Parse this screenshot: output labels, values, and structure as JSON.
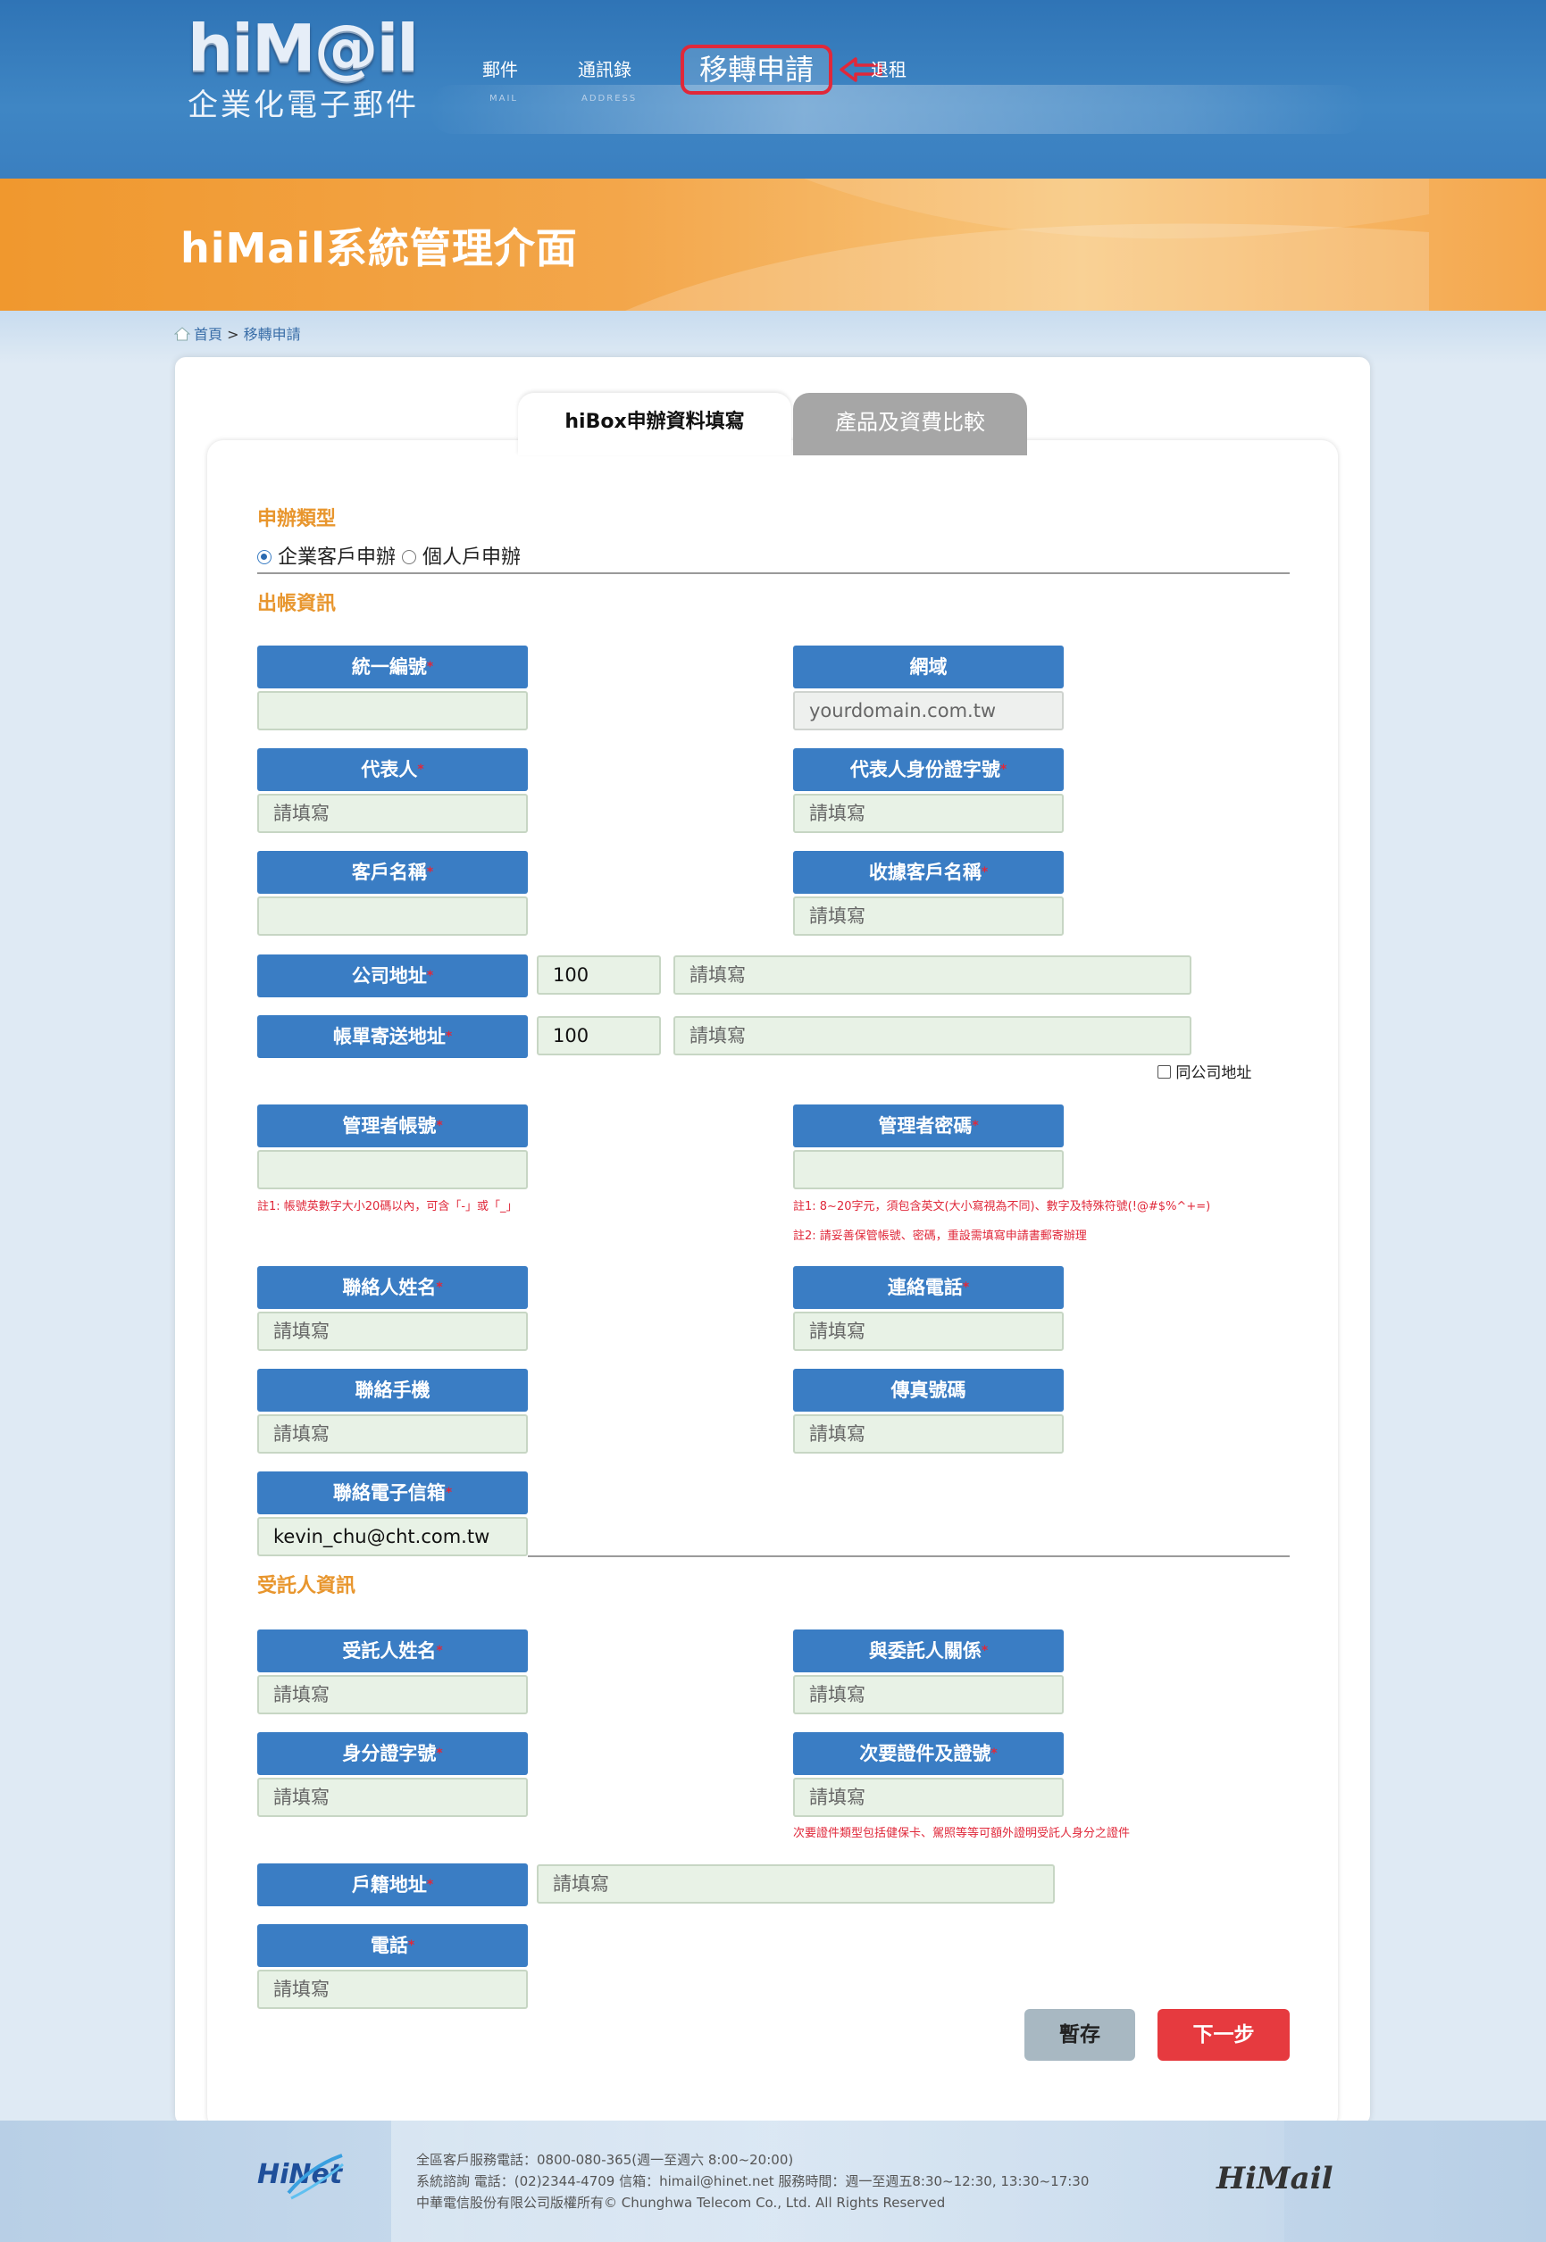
{
  "header": {
    "logo_main": "hiM@il",
    "logo_sub": "企業化電子郵件",
    "nav": [
      {
        "label": "郵件",
        "sub": "MAIL"
      },
      {
        "label": "通訊錄",
        "sub": "ADDRESS"
      },
      {
        "label": "移轉申請"
      },
      {
        "label": "退租"
      }
    ]
  },
  "banner": {
    "title": "hiMail系統管理介面"
  },
  "breadcrumb": {
    "home": "首頁",
    "sep": ">",
    "current": "移轉申請"
  },
  "tabs": [
    {
      "label": "hiBox申辦資料填寫"
    },
    {
      "label": "產品及資費比較"
    }
  ],
  "apply_type": {
    "title": "申辦類型",
    "options": [
      {
        "label": "企業客戶申辦",
        "checked": true
      },
      {
        "label": "個人戶申辦",
        "checked": false
      }
    ]
  },
  "billing": {
    "title": "出帳資訊",
    "fields": {
      "tax_id": {
        "label": "統一編號",
        "value": ""
      },
      "domain": {
        "label": "網域",
        "placeholder": "yourdomain.com.tw"
      },
      "representative": {
        "label": "代表人",
        "placeholder": "請填寫"
      },
      "rep_id": {
        "label": "代表人身份證字號",
        "placeholder": "請填寫"
      },
      "customer_name": {
        "label": "客戶名稱",
        "value": ""
      },
      "receipt_name": {
        "label": "收據客戶名稱",
        "placeholder": "請填寫"
      },
      "company_address": {
        "label": "公司地址",
        "zip": "100",
        "placeholder": "請填寫"
      },
      "bill_address": {
        "label": "帳單寄送地址",
        "zip": "100",
        "placeholder": "請填寫"
      },
      "same_address": {
        "label": "同公司地址"
      },
      "admin_account": {
        "label": "管理者帳號",
        "note": "註1: 帳號英數字大小20碼以內，可含「-」或「_」"
      },
      "admin_password": {
        "label": "管理者密碼",
        "note1": "註1: 8~20字元，須包含英文(大小寫視為不同)、數字及特殊符號(!@#$%^+=)",
        "note2": "註2: 請妥善保管帳號、密碼，重設需填寫申請書郵寄辦理"
      },
      "contact_name": {
        "label": "聯絡人姓名",
        "placeholder": "請填寫"
      },
      "contact_phone": {
        "label": "連絡電話",
        "placeholder": "請填寫"
      },
      "mobile": {
        "label": "聯絡手機",
        "placeholder": "請填寫"
      },
      "fax": {
        "label": "傳真號碼",
        "placeholder": "請填寫"
      },
      "email": {
        "label": "聯絡電子信箱",
        "value": "kevin_chu@cht.com.tw"
      }
    }
  },
  "trustee": {
    "title": "受託人資訊",
    "fields": {
      "name": {
        "label": "受託人姓名",
        "placeholder": "請填寫"
      },
      "relation": {
        "label": "與委託人關係",
        "placeholder": "請填寫"
      },
      "id_no": {
        "label": "身分證字號",
        "placeholder": "請填寫"
      },
      "second_id": {
        "label": "次要證件及證號",
        "placeholder": "請填寫",
        "note": "次要證件類型包括健保卡、駕照等等可額外證明受託人身分之證件"
      },
      "household": {
        "label": "戶籍地址",
        "placeholder": "請填寫"
      },
      "phone": {
        "label": "電話",
        "placeholder": "請填寫"
      }
    }
  },
  "buttons": {
    "save": "暫存",
    "next": "下一步"
  },
  "footer": {
    "hinet": "HiNet",
    "line1": "全區客戶服務電話：0800-080-365(週一至週六 8:00~20:00)",
    "line2": "系統諮詢  電話：(02)2344-4709  信箱：himail@hinet.net  服務時間：週一至週五8:30~12:30, 13:30~17:30",
    "line3": "中華電信股份有限公司版權所有© Chunghwa Telecom Co., Ltd. All Rights Reserved",
    "himail": "HiMail"
  },
  "colors": {
    "header_blue": "#2f74b6",
    "banner_orange": "#f0982e",
    "label_blue": "#3a7dc4",
    "section_orange": "#e8962e",
    "required_red": "#e0283a",
    "next_red": "#e63a3f",
    "save_gray": "#a8b8c2"
  }
}
